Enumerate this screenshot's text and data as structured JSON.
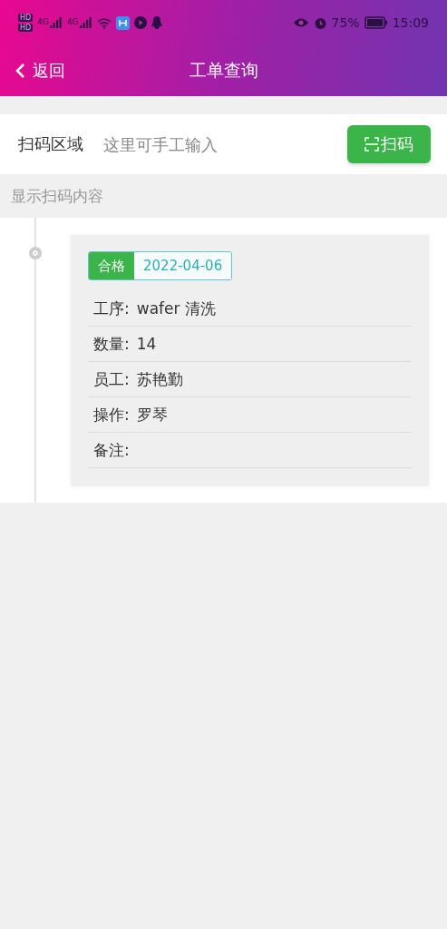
{
  "status_bar": {
    "sim_labels": [
      "HD",
      "HD"
    ],
    "network_labels": [
      "4G",
      "4G"
    ],
    "battery_percent": "75%",
    "time": "15:09"
  },
  "header": {
    "back_label": "返回",
    "title": "工单查询"
  },
  "scan": {
    "label": "扫码区域",
    "placeholder": "这里可手工输入",
    "button": "扫码"
  },
  "result_heading": "显示扫码内容",
  "records": [
    {
      "status": "合格",
      "passed": true,
      "date": "2022-04-06",
      "fields": [
        {
          "label": "工序:",
          "value": "wafer 清洗"
        },
        {
          "label": "数量:",
          "value": "14"
        },
        {
          "label": "员工:",
          "value": "苏艳勤"
        },
        {
          "label": "操作:",
          "value": "罗琴"
        },
        {
          "label": "备注:"
        }
      ]
    }
  ]
}
